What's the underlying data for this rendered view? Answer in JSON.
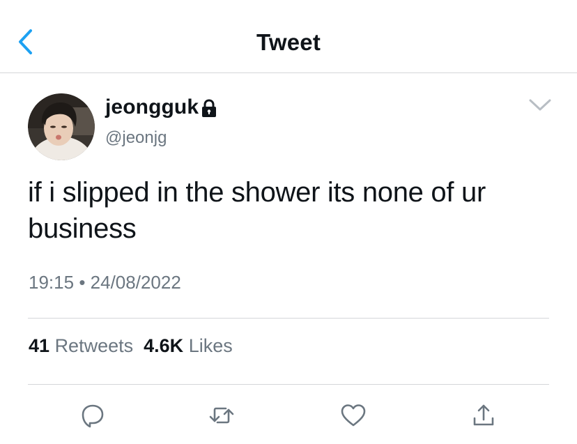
{
  "header": {
    "title": "Tweet",
    "back_icon": "chevron-left-icon"
  },
  "tweet": {
    "author": {
      "display_name": "jeongguk",
      "handle": "@jeonjg",
      "protected_icon": "lock-icon"
    },
    "text": "if i slipped in the shower its none of ur business",
    "time": "19:15",
    "separator": "•",
    "date": "24/08/2022",
    "stats": {
      "retweets_count": "41",
      "retweets_label": "Retweets",
      "likes_count": "4.6K",
      "likes_label": "Likes"
    },
    "actions": [
      "reply-icon",
      "retweet-icon",
      "like-icon",
      "share-icon"
    ]
  },
  "colors": {
    "accent": "#1da1f2",
    "text": "#0f1419",
    "secondary": "#6b7680",
    "divider": "#d4d6d9",
    "icon": "#6b7680"
  }
}
